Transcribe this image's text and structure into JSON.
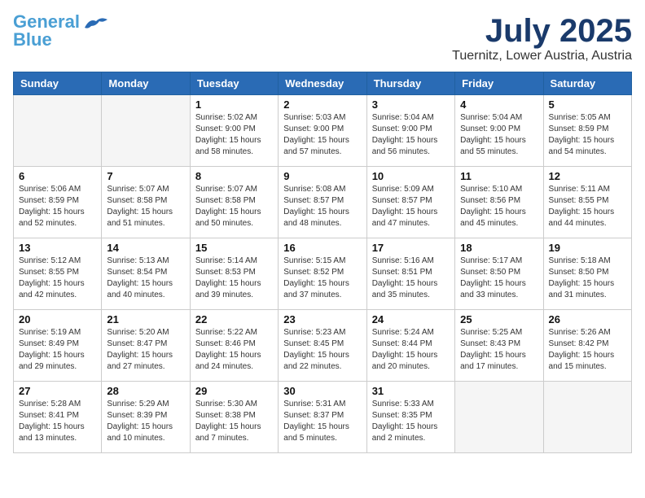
{
  "header": {
    "logo_general": "General",
    "logo_blue": "Blue",
    "month": "July 2025",
    "location": "Tuernitz, Lower Austria, Austria"
  },
  "weekdays": [
    "Sunday",
    "Monday",
    "Tuesday",
    "Wednesday",
    "Thursday",
    "Friday",
    "Saturday"
  ],
  "weeks": [
    [
      {
        "day": "",
        "sunrise": "",
        "sunset": "",
        "daylight": "",
        "empty": true
      },
      {
        "day": "",
        "sunrise": "",
        "sunset": "",
        "daylight": "",
        "empty": true
      },
      {
        "day": "1",
        "sunrise": "Sunrise: 5:02 AM",
        "sunset": "Sunset: 9:00 PM",
        "daylight": "Daylight: 15 hours and 58 minutes."
      },
      {
        "day": "2",
        "sunrise": "Sunrise: 5:03 AM",
        "sunset": "Sunset: 9:00 PM",
        "daylight": "Daylight: 15 hours and 57 minutes."
      },
      {
        "day": "3",
        "sunrise": "Sunrise: 5:04 AM",
        "sunset": "Sunset: 9:00 PM",
        "daylight": "Daylight: 15 hours and 56 minutes."
      },
      {
        "day": "4",
        "sunrise": "Sunrise: 5:04 AM",
        "sunset": "Sunset: 9:00 PM",
        "daylight": "Daylight: 15 hours and 55 minutes."
      },
      {
        "day": "5",
        "sunrise": "Sunrise: 5:05 AM",
        "sunset": "Sunset: 8:59 PM",
        "daylight": "Daylight: 15 hours and 54 minutes."
      }
    ],
    [
      {
        "day": "6",
        "sunrise": "Sunrise: 5:06 AM",
        "sunset": "Sunset: 8:59 PM",
        "daylight": "Daylight: 15 hours and 52 minutes."
      },
      {
        "day": "7",
        "sunrise": "Sunrise: 5:07 AM",
        "sunset": "Sunset: 8:58 PM",
        "daylight": "Daylight: 15 hours and 51 minutes."
      },
      {
        "day": "8",
        "sunrise": "Sunrise: 5:07 AM",
        "sunset": "Sunset: 8:58 PM",
        "daylight": "Daylight: 15 hours and 50 minutes."
      },
      {
        "day": "9",
        "sunrise": "Sunrise: 5:08 AM",
        "sunset": "Sunset: 8:57 PM",
        "daylight": "Daylight: 15 hours and 48 minutes."
      },
      {
        "day": "10",
        "sunrise": "Sunrise: 5:09 AM",
        "sunset": "Sunset: 8:57 PM",
        "daylight": "Daylight: 15 hours and 47 minutes."
      },
      {
        "day": "11",
        "sunrise": "Sunrise: 5:10 AM",
        "sunset": "Sunset: 8:56 PM",
        "daylight": "Daylight: 15 hours and 45 minutes."
      },
      {
        "day": "12",
        "sunrise": "Sunrise: 5:11 AM",
        "sunset": "Sunset: 8:55 PM",
        "daylight": "Daylight: 15 hours and 44 minutes."
      }
    ],
    [
      {
        "day": "13",
        "sunrise": "Sunrise: 5:12 AM",
        "sunset": "Sunset: 8:55 PM",
        "daylight": "Daylight: 15 hours and 42 minutes."
      },
      {
        "day": "14",
        "sunrise": "Sunrise: 5:13 AM",
        "sunset": "Sunset: 8:54 PM",
        "daylight": "Daylight: 15 hours and 40 minutes."
      },
      {
        "day": "15",
        "sunrise": "Sunrise: 5:14 AM",
        "sunset": "Sunset: 8:53 PM",
        "daylight": "Daylight: 15 hours and 39 minutes."
      },
      {
        "day": "16",
        "sunrise": "Sunrise: 5:15 AM",
        "sunset": "Sunset: 8:52 PM",
        "daylight": "Daylight: 15 hours and 37 minutes."
      },
      {
        "day": "17",
        "sunrise": "Sunrise: 5:16 AM",
        "sunset": "Sunset: 8:51 PM",
        "daylight": "Daylight: 15 hours and 35 minutes."
      },
      {
        "day": "18",
        "sunrise": "Sunrise: 5:17 AM",
        "sunset": "Sunset: 8:50 PM",
        "daylight": "Daylight: 15 hours and 33 minutes."
      },
      {
        "day": "19",
        "sunrise": "Sunrise: 5:18 AM",
        "sunset": "Sunset: 8:50 PM",
        "daylight": "Daylight: 15 hours and 31 minutes."
      }
    ],
    [
      {
        "day": "20",
        "sunrise": "Sunrise: 5:19 AM",
        "sunset": "Sunset: 8:49 PM",
        "daylight": "Daylight: 15 hours and 29 minutes."
      },
      {
        "day": "21",
        "sunrise": "Sunrise: 5:20 AM",
        "sunset": "Sunset: 8:47 PM",
        "daylight": "Daylight: 15 hours and 27 minutes."
      },
      {
        "day": "22",
        "sunrise": "Sunrise: 5:22 AM",
        "sunset": "Sunset: 8:46 PM",
        "daylight": "Daylight: 15 hours and 24 minutes."
      },
      {
        "day": "23",
        "sunrise": "Sunrise: 5:23 AM",
        "sunset": "Sunset: 8:45 PM",
        "daylight": "Daylight: 15 hours and 22 minutes."
      },
      {
        "day": "24",
        "sunrise": "Sunrise: 5:24 AM",
        "sunset": "Sunset: 8:44 PM",
        "daylight": "Daylight: 15 hours and 20 minutes."
      },
      {
        "day": "25",
        "sunrise": "Sunrise: 5:25 AM",
        "sunset": "Sunset: 8:43 PM",
        "daylight": "Daylight: 15 hours and 17 minutes."
      },
      {
        "day": "26",
        "sunrise": "Sunrise: 5:26 AM",
        "sunset": "Sunset: 8:42 PM",
        "daylight": "Daylight: 15 hours and 15 minutes."
      }
    ],
    [
      {
        "day": "27",
        "sunrise": "Sunrise: 5:28 AM",
        "sunset": "Sunset: 8:41 PM",
        "daylight": "Daylight: 15 hours and 13 minutes."
      },
      {
        "day": "28",
        "sunrise": "Sunrise: 5:29 AM",
        "sunset": "Sunset: 8:39 PM",
        "daylight": "Daylight: 15 hours and 10 minutes."
      },
      {
        "day": "29",
        "sunrise": "Sunrise: 5:30 AM",
        "sunset": "Sunset: 8:38 PM",
        "daylight": "Daylight: 15 hours and 7 minutes."
      },
      {
        "day": "30",
        "sunrise": "Sunrise: 5:31 AM",
        "sunset": "Sunset: 8:37 PM",
        "daylight": "Daylight: 15 hours and 5 minutes."
      },
      {
        "day": "31",
        "sunrise": "Sunrise: 5:33 AM",
        "sunset": "Sunset: 8:35 PM",
        "daylight": "Daylight: 15 hours and 2 minutes."
      },
      {
        "day": "",
        "sunrise": "",
        "sunset": "",
        "daylight": "",
        "empty": true
      },
      {
        "day": "",
        "sunrise": "",
        "sunset": "",
        "daylight": "",
        "empty": true
      }
    ]
  ]
}
